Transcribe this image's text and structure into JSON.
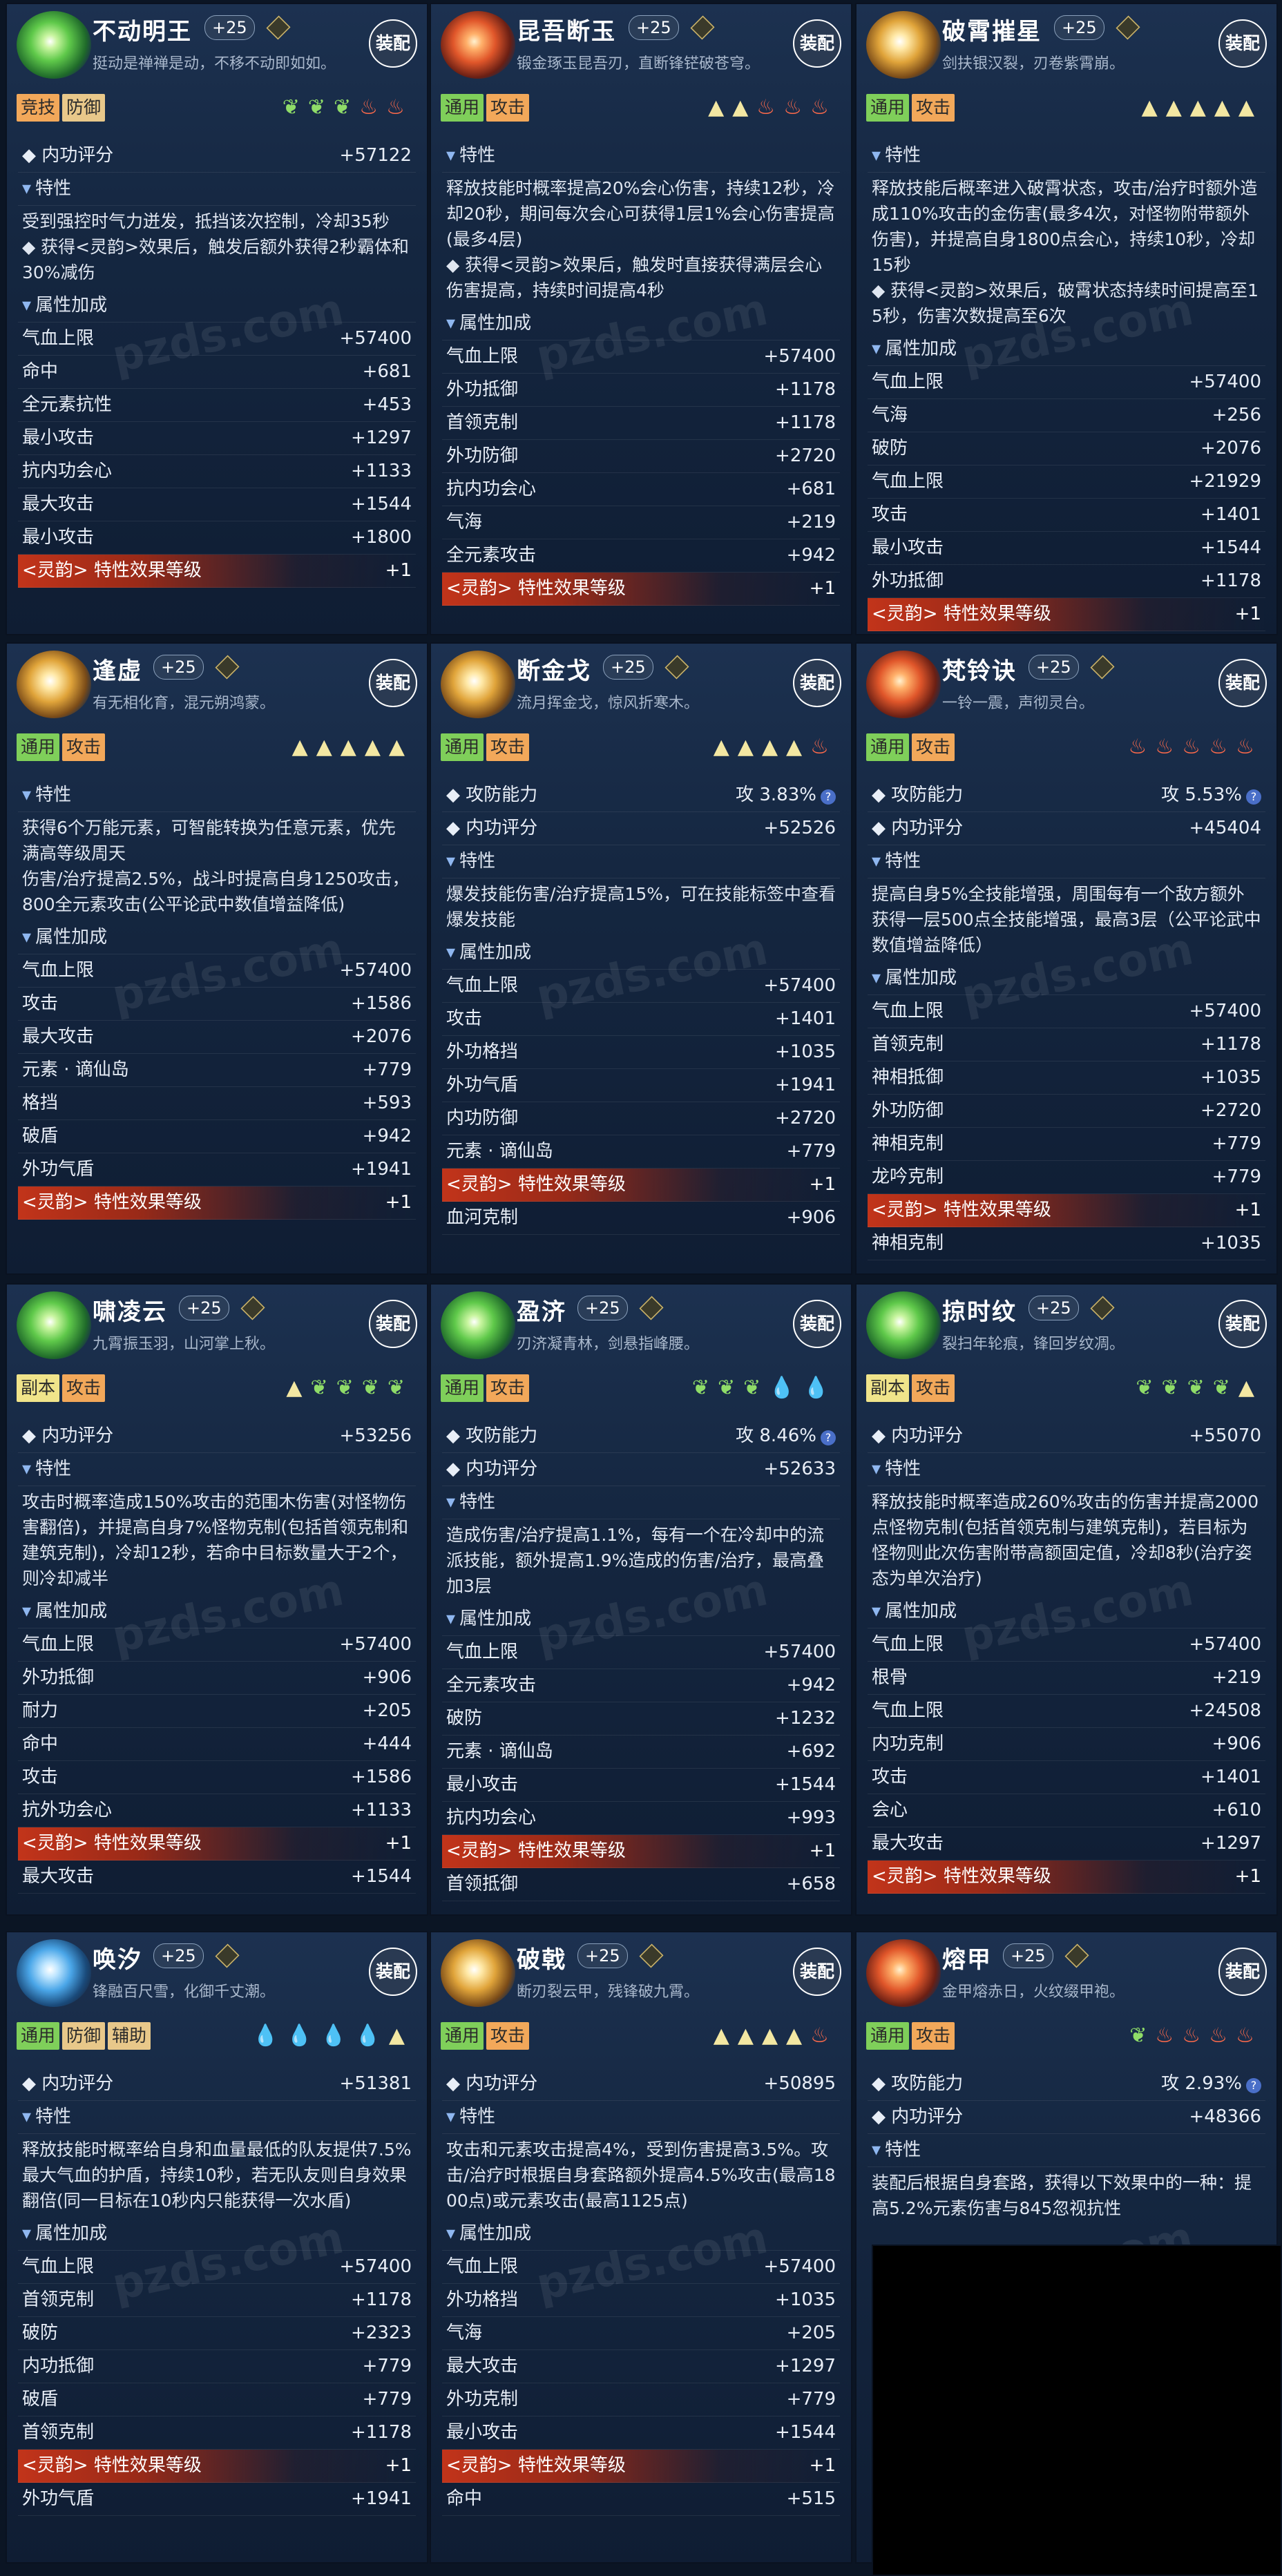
{
  "watermark": "pzds.com",
  "equip_label": "装配",
  "cards": [
    {
      "name": "不动明王",
      "level": "+25",
      "motto": "挺动是禅禅是动，不移不动即如如。",
      "emblem": "green",
      "tags": [
        {
          "t": "竞技",
          "c": "t-orange"
        },
        {
          "t": "防御",
          "c": "t-tan"
        }
      ],
      "marks": [
        {
          "s": "leaf",
          "n": 3
        },
        {
          "s": "fire",
          "n": 2
        }
      ],
      "rows": [
        {
          "type": "stat",
          "k": "◆ 内功评分",
          "v": "+57122"
        },
        {
          "type": "sec",
          "k": "特性"
        },
        {
          "type": "desc",
          "text": "受到强控时气力迸发，抵挡该次控制，冷却35秒\n◆ 获得<灵韵>效果后，触发后额外获得2秒霸体和30%减伤"
        },
        {
          "type": "sec",
          "k": "属性加成"
        },
        {
          "type": "stat",
          "k": "气血上限",
          "v": "+57400"
        },
        {
          "type": "stat",
          "k": "命中",
          "v": "+681"
        },
        {
          "type": "stat",
          "k": "全元素抗性",
          "v": "+453"
        },
        {
          "type": "stat",
          "k": "最小攻击",
          "v": "+1297"
        },
        {
          "type": "stat",
          "k": "抗内功会心",
          "v": "+1133"
        },
        {
          "type": "stat",
          "k": "最大攻击",
          "v": "+1544"
        },
        {
          "type": "stat",
          "k": "最小攻击",
          "v": "+1800"
        },
        {
          "type": "acc",
          "k": "<灵韵> 特性效果等级",
          "v": "+1"
        }
      ]
    },
    {
      "name": "昆吾断玉",
      "level": "+25",
      "motto": "锻金琢玉昆吾刃，直断锋铓破苍穹。",
      "emblem": "red",
      "tags": [
        {
          "t": "通用",
          "c": "t-green"
        },
        {
          "t": "攻击",
          "c": "t-orange"
        }
      ],
      "marks": [
        {
          "s": "tri",
          "n": 2
        },
        {
          "s": "fire",
          "n": 3
        }
      ],
      "rows": [
        {
          "type": "sec",
          "k": "特性"
        },
        {
          "type": "desc",
          "text": "释放技能时概率提高20%会心伤害，持续12秒，冷却20秒，期间每次会心可获得1层1%会心伤害提高(最多4层)\n◆ 获得<灵韵>效果后，触发时直接获得满层会心伤害提高，持续时间提高4秒"
        },
        {
          "type": "sec",
          "k": "属性加成"
        },
        {
          "type": "stat",
          "k": "气血上限",
          "v": "+57400"
        },
        {
          "type": "stat",
          "k": "外功抵御",
          "v": "+1178"
        },
        {
          "type": "stat",
          "k": "首领克制",
          "v": "+1178"
        },
        {
          "type": "stat",
          "k": "外功防御",
          "v": "+2720"
        },
        {
          "type": "stat",
          "k": "抗内功会心",
          "v": "+681"
        },
        {
          "type": "stat",
          "k": "气海",
          "v": "+219"
        },
        {
          "type": "stat",
          "k": "全元素攻击",
          "v": "+942"
        },
        {
          "type": "acc",
          "k": "<灵韵> 特性效果等级",
          "v": "+1"
        }
      ]
    },
    {
      "name": "破霄摧星",
      "level": "+25",
      "motto": "剑扶银汉裂，刃卷紫霄崩。",
      "emblem": "gold",
      "tags": [
        {
          "t": "通用",
          "c": "t-green"
        },
        {
          "t": "攻击",
          "c": "t-orange"
        }
      ],
      "marks": [
        {
          "s": "tri",
          "n": 5
        }
      ],
      "rows": [
        {
          "type": "sec",
          "k": "特性"
        },
        {
          "type": "desc",
          "text": "释放技能后概率进入破霄状态，攻击/治疗时额外造成110%攻击的金伤害(最多4次，对怪物附带额外伤害)，并提高自身1800点会心，持续10秒，冷却15秒\n◆ 获得<灵韵>效果后，破霄状态持续时间提高至15秒，伤害次数提高至6次"
        },
        {
          "type": "sec",
          "k": "属性加成"
        },
        {
          "type": "stat",
          "k": "气血上限",
          "v": "+57400"
        },
        {
          "type": "stat",
          "k": "气海",
          "v": "+256"
        },
        {
          "type": "stat",
          "k": "破防",
          "v": "+2076"
        },
        {
          "type": "stat",
          "k": "气血上限",
          "v": "+21929"
        },
        {
          "type": "stat",
          "k": "攻击",
          "v": "+1401"
        },
        {
          "type": "stat",
          "k": "最小攻击",
          "v": "+1544"
        },
        {
          "type": "stat",
          "k": "外功抵御",
          "v": "+1178"
        },
        {
          "type": "acc",
          "k": "<灵韵> 特性效果等级",
          "v": "+1"
        }
      ]
    },
    {
      "name": "逢虚",
      "level": "+25",
      "motto": "有无相化育，混元朔鸿蒙。",
      "emblem": "gold",
      "tags": [
        {
          "t": "通用",
          "c": "t-green"
        },
        {
          "t": "攻击",
          "c": "t-orange"
        }
      ],
      "marks": [
        {
          "s": "tri",
          "n": 5
        }
      ],
      "rows": [
        {
          "type": "sec",
          "k": "特性"
        },
        {
          "type": "desc",
          "text": "获得6个万能元素，可智能转换为任意元素，优先满高等级周天\n伤害/治疗提高2.5%，战斗时提高自身1250攻击，800全元素攻击(公平论武中数值增益降低)"
        },
        {
          "type": "sec",
          "k": "属性加成"
        },
        {
          "type": "stat",
          "k": "气血上限",
          "v": "+57400"
        },
        {
          "type": "stat",
          "k": "攻击",
          "v": "+1586"
        },
        {
          "type": "stat",
          "k": "最大攻击",
          "v": "+2076"
        },
        {
          "type": "stat",
          "k": "元素 · 谪仙岛",
          "v": "+779"
        },
        {
          "type": "stat",
          "k": "格挡",
          "v": "+593"
        },
        {
          "type": "stat",
          "k": "破盾",
          "v": "+942"
        },
        {
          "type": "stat",
          "k": "外功气盾",
          "v": "+1941"
        },
        {
          "type": "acc",
          "k": "<灵韵> 特性效果等级",
          "v": "+1"
        }
      ]
    },
    {
      "name": "断金戈",
      "level": "+25",
      "motto": "流月挥金戈，惊风折寒木。",
      "emblem": "gold",
      "tags": [
        {
          "t": "通用",
          "c": "t-green"
        },
        {
          "t": "攻击",
          "c": "t-orange"
        }
      ],
      "marks": [
        {
          "s": "tri",
          "n": 4
        },
        {
          "s": "fire",
          "n": 1
        }
      ],
      "rows": [
        {
          "type": "stat",
          "k": "◆ 攻防能力",
          "v": "攻 3.83%",
          "q": true
        },
        {
          "type": "stat",
          "k": "◆ 内功评分",
          "v": "+52526"
        },
        {
          "type": "sec",
          "k": "特性"
        },
        {
          "type": "desc",
          "text": "爆发技能伤害/治疗提高15%，可在技能标签中查看爆发技能"
        },
        {
          "type": "sec",
          "k": "属性加成"
        },
        {
          "type": "stat",
          "k": "气血上限",
          "v": "+57400"
        },
        {
          "type": "stat",
          "k": "攻击",
          "v": "+1401"
        },
        {
          "type": "stat",
          "k": "外功格挡",
          "v": "+1035"
        },
        {
          "type": "stat",
          "k": "外功气盾",
          "v": "+1941"
        },
        {
          "type": "stat",
          "k": "内功防御",
          "v": "+2720"
        },
        {
          "type": "stat",
          "k": "元素 · 谪仙岛",
          "v": "+779"
        },
        {
          "type": "acc",
          "k": "<灵韵> 特性效果等级",
          "v": "+1"
        },
        {
          "type": "stat",
          "k": "血河克制",
          "v": "+906"
        }
      ]
    },
    {
      "name": "梵铃诀",
      "level": "+25",
      "motto": "一铃一震，声彻灵台。",
      "emblem": "red",
      "tags": [
        {
          "t": "通用",
          "c": "t-green"
        },
        {
          "t": "攻击",
          "c": "t-orange"
        }
      ],
      "marks": [
        {
          "s": "fire",
          "n": 5
        }
      ],
      "rows": [
        {
          "type": "stat",
          "k": "◆ 攻防能力",
          "v": "攻 5.53%",
          "q": true
        },
        {
          "type": "stat",
          "k": "◆ 内功评分",
          "v": "+45404"
        },
        {
          "type": "sec",
          "k": "特性"
        },
        {
          "type": "desc",
          "text": "提高自身5%全技能增强，周围每有一个敌方额外获得一层500点全技能增强，最高3层（公平论武中数值增益降低）"
        },
        {
          "type": "sec",
          "k": "属性加成"
        },
        {
          "type": "stat",
          "k": "气血上限",
          "v": "+57400"
        },
        {
          "type": "stat",
          "k": "首领克制",
          "v": "+1178"
        },
        {
          "type": "stat",
          "k": "神相抵御",
          "v": "+1035"
        },
        {
          "type": "stat",
          "k": "外功防御",
          "v": "+2720"
        },
        {
          "type": "stat",
          "k": "神相克制",
          "v": "+779"
        },
        {
          "type": "stat",
          "k": "龙吟克制",
          "v": "+779"
        },
        {
          "type": "acc",
          "k": "<灵韵> 特性效果等级",
          "v": "+1"
        },
        {
          "type": "stat",
          "k": "神相克制",
          "v": "+1035"
        }
      ]
    },
    {
      "name": "啸凌云",
      "level": "+25",
      "motto": "九霄振玉羽，山河掌上秋。",
      "emblem": "green",
      "tags": [
        {
          "t": "副本",
          "c": "t-yellow"
        },
        {
          "t": "攻击",
          "c": "t-orange"
        }
      ],
      "marks": [
        {
          "s": "tri",
          "n": 1
        },
        {
          "s": "leaf",
          "n": 4
        }
      ],
      "rows": [
        {
          "type": "stat",
          "k": "◆ 内功评分",
          "v": "+53256"
        },
        {
          "type": "sec",
          "k": "特性"
        },
        {
          "type": "desc",
          "text": "攻击时概率造成150%攻击的范围木伤害(对怪物伤害翻倍)，并提高自身7%怪物克制(包括首领克制和建筑克制)，冷却12秒，若命中目标数量大于2个，则冷却减半"
        },
        {
          "type": "sec",
          "k": "属性加成"
        },
        {
          "type": "stat",
          "k": "气血上限",
          "v": "+57400"
        },
        {
          "type": "stat",
          "k": "外功抵御",
          "v": "+906"
        },
        {
          "type": "stat",
          "k": "耐力",
          "v": "+205"
        },
        {
          "type": "stat",
          "k": "命中",
          "v": "+444"
        },
        {
          "type": "stat",
          "k": "攻击",
          "v": "+1586"
        },
        {
          "type": "stat",
          "k": "抗外功会心",
          "v": "+1133"
        },
        {
          "type": "acc",
          "k": "<灵韵> 特性效果等级",
          "v": "+1"
        },
        {
          "type": "stat",
          "k": "最大攻击",
          "v": "+1544"
        }
      ]
    },
    {
      "name": "盈济",
      "level": "+25",
      "motto": "刃济凝青林，剑悬指峰腰。",
      "emblem": "green",
      "tags": [
        {
          "t": "通用",
          "c": "t-green"
        },
        {
          "t": "攻击",
          "c": "t-orange"
        }
      ],
      "marks": [
        {
          "s": "leaf",
          "n": 3
        },
        {
          "s": "drop",
          "n": 2
        }
      ],
      "rows": [
        {
          "type": "stat",
          "k": "◆ 攻防能力",
          "v": "攻 8.46%",
          "q": true
        },
        {
          "type": "stat",
          "k": "◆ 内功评分",
          "v": "+52633"
        },
        {
          "type": "sec",
          "k": "特性"
        },
        {
          "type": "desc",
          "text": "造成伤害/治疗提高1.1%，每有一个在冷却中的流派技能，额外提高1.9%造成的伤害/治疗，最高叠加3层"
        },
        {
          "type": "sec",
          "k": "属性加成"
        },
        {
          "type": "stat",
          "k": "气血上限",
          "v": "+57400"
        },
        {
          "type": "stat",
          "k": "全元素攻击",
          "v": "+942"
        },
        {
          "type": "stat",
          "k": "破防",
          "v": "+1232"
        },
        {
          "type": "stat",
          "k": "元素 · 谪仙岛",
          "v": "+692"
        },
        {
          "type": "stat",
          "k": "最小攻击",
          "v": "+1544"
        },
        {
          "type": "stat",
          "k": "抗内功会心",
          "v": "+993"
        },
        {
          "type": "acc",
          "k": "<灵韵> 特性效果等级",
          "v": "+1"
        },
        {
          "type": "stat",
          "k": "首领抵御",
          "v": "+658"
        }
      ]
    },
    {
      "name": "掠时纹",
      "level": "+25",
      "motto": "裂扫年轮痕，锋回岁纹凋。",
      "emblem": "green",
      "tags": [
        {
          "t": "副本",
          "c": "t-yellow"
        },
        {
          "t": "攻击",
          "c": "t-orange"
        }
      ],
      "marks": [
        {
          "s": "leaf",
          "n": 4
        },
        {
          "s": "tri",
          "n": 1
        }
      ],
      "rows": [
        {
          "type": "stat",
          "k": "◆ 内功评分",
          "v": "+55070"
        },
        {
          "type": "sec",
          "k": "特性"
        },
        {
          "type": "desc",
          "text": "释放技能时概率造成260%攻击的伤害并提高2000点怪物克制(包括首领克制与建筑克制)，若目标为怪物则此次伤害附带高额固定值，冷却8秒(治疗姿态为单次治疗)"
        },
        {
          "type": "sec",
          "k": "属性加成"
        },
        {
          "type": "stat",
          "k": "气血上限",
          "v": "+57400"
        },
        {
          "type": "stat",
          "k": "根骨",
          "v": "+219"
        },
        {
          "type": "stat",
          "k": "气血上限",
          "v": "+24508"
        },
        {
          "type": "stat",
          "k": "内功克制",
          "v": "+906"
        },
        {
          "type": "stat",
          "k": "攻击",
          "v": "+1401"
        },
        {
          "type": "stat",
          "k": "会心",
          "v": "+610"
        },
        {
          "type": "stat",
          "k": "最大攻击",
          "v": "+1297"
        },
        {
          "type": "acc",
          "k": "<灵韵> 特性效果等级",
          "v": "+1"
        }
      ]
    },
    {
      "name": "唤汐",
      "level": "+25",
      "motto": "锋融百尺雪，化御千丈潮。",
      "emblem": "blue",
      "tags": [
        {
          "t": "通用",
          "c": "t-green"
        },
        {
          "t": "防御",
          "c": "t-tan"
        },
        {
          "t": "辅助",
          "c": "t-tan"
        }
      ],
      "marks": [
        {
          "s": "drop",
          "n": 4
        },
        {
          "s": "tri",
          "n": 1
        }
      ],
      "rows": [
        {
          "type": "stat",
          "k": "◆ 内功评分",
          "v": "+51381"
        },
        {
          "type": "sec",
          "k": "特性"
        },
        {
          "type": "desc",
          "text": "释放技能时概率给自身和血量最低的队友提供7.5%最大气血的护盾，持续10秒，若无队友则自身效果翻倍(同一目标在10秒内只能获得一次水盾)"
        },
        {
          "type": "sec",
          "k": "属性加成"
        },
        {
          "type": "stat",
          "k": "气血上限",
          "v": "+57400"
        },
        {
          "type": "stat",
          "k": "首领克制",
          "v": "+1178"
        },
        {
          "type": "stat",
          "k": "破防",
          "v": "+2323"
        },
        {
          "type": "stat",
          "k": "内功抵御",
          "v": "+779"
        },
        {
          "type": "stat",
          "k": "破盾",
          "v": "+779"
        },
        {
          "type": "stat",
          "k": "首领克制",
          "v": "+1178"
        },
        {
          "type": "acc",
          "k": "<灵韵> 特性效果等级",
          "v": "+1"
        },
        {
          "type": "stat",
          "k": "外功气盾",
          "v": "+1941"
        }
      ]
    },
    {
      "name": "破戟",
      "level": "+25",
      "motto": "断刃裂云甲，残锋破九霄。",
      "emblem": "gold",
      "tags": [
        {
          "t": "通用",
          "c": "t-green"
        },
        {
          "t": "攻击",
          "c": "t-orange"
        }
      ],
      "marks": [
        {
          "s": "tri",
          "n": 4
        },
        {
          "s": "fire",
          "n": 1
        }
      ],
      "rows": [
        {
          "type": "stat",
          "k": "◆ 内功评分",
          "v": "+50895"
        },
        {
          "type": "sec",
          "k": "特性"
        },
        {
          "type": "desc",
          "text": "攻击和元素攻击提高4%，受到伤害提高3.5%。攻击/治疗时根据自身套路额外提高4.5%攻击(最高1800点)或元素攻击(最高1125点)"
        },
        {
          "type": "sec",
          "k": "属性加成"
        },
        {
          "type": "stat",
          "k": "气血上限",
          "v": "+57400"
        },
        {
          "type": "stat",
          "k": "外功格挡",
          "v": "+1035"
        },
        {
          "type": "stat",
          "k": "气海",
          "v": "+205"
        },
        {
          "type": "stat",
          "k": "最大攻击",
          "v": "+1297"
        },
        {
          "type": "stat",
          "k": "外功克制",
          "v": "+779"
        },
        {
          "type": "stat",
          "k": "最小攻击",
          "v": "+1544"
        },
        {
          "type": "acc",
          "k": "<灵韵> 特性效果等级",
          "v": "+1"
        },
        {
          "type": "stat",
          "k": "命中",
          "v": "+515"
        }
      ]
    },
    {
      "name": "熔甲",
      "level": "+25",
      "motto": "金甲熔赤日，火纹缀甲袍。",
      "emblem": "red",
      "tags": [
        {
          "t": "通用",
          "c": "t-green"
        },
        {
          "t": "攻击",
          "c": "t-orange"
        }
      ],
      "marks": [
        {
          "s": "leaf",
          "n": 1
        },
        {
          "s": "fire",
          "n": 4
        }
      ],
      "rows": [
        {
          "type": "stat",
          "k": "◆ 攻防能力",
          "v": "攻 2.93%",
          "q": true
        },
        {
          "type": "stat",
          "k": "◆ 内功评分",
          "v": "+48366"
        },
        {
          "type": "sec",
          "k": "特性"
        },
        {
          "type": "desc",
          "text": "装配后根据自身套路，获得以下效果中的一种：提高5.2%元素伤害与845忽视抗性"
        }
      ]
    }
  ]
}
